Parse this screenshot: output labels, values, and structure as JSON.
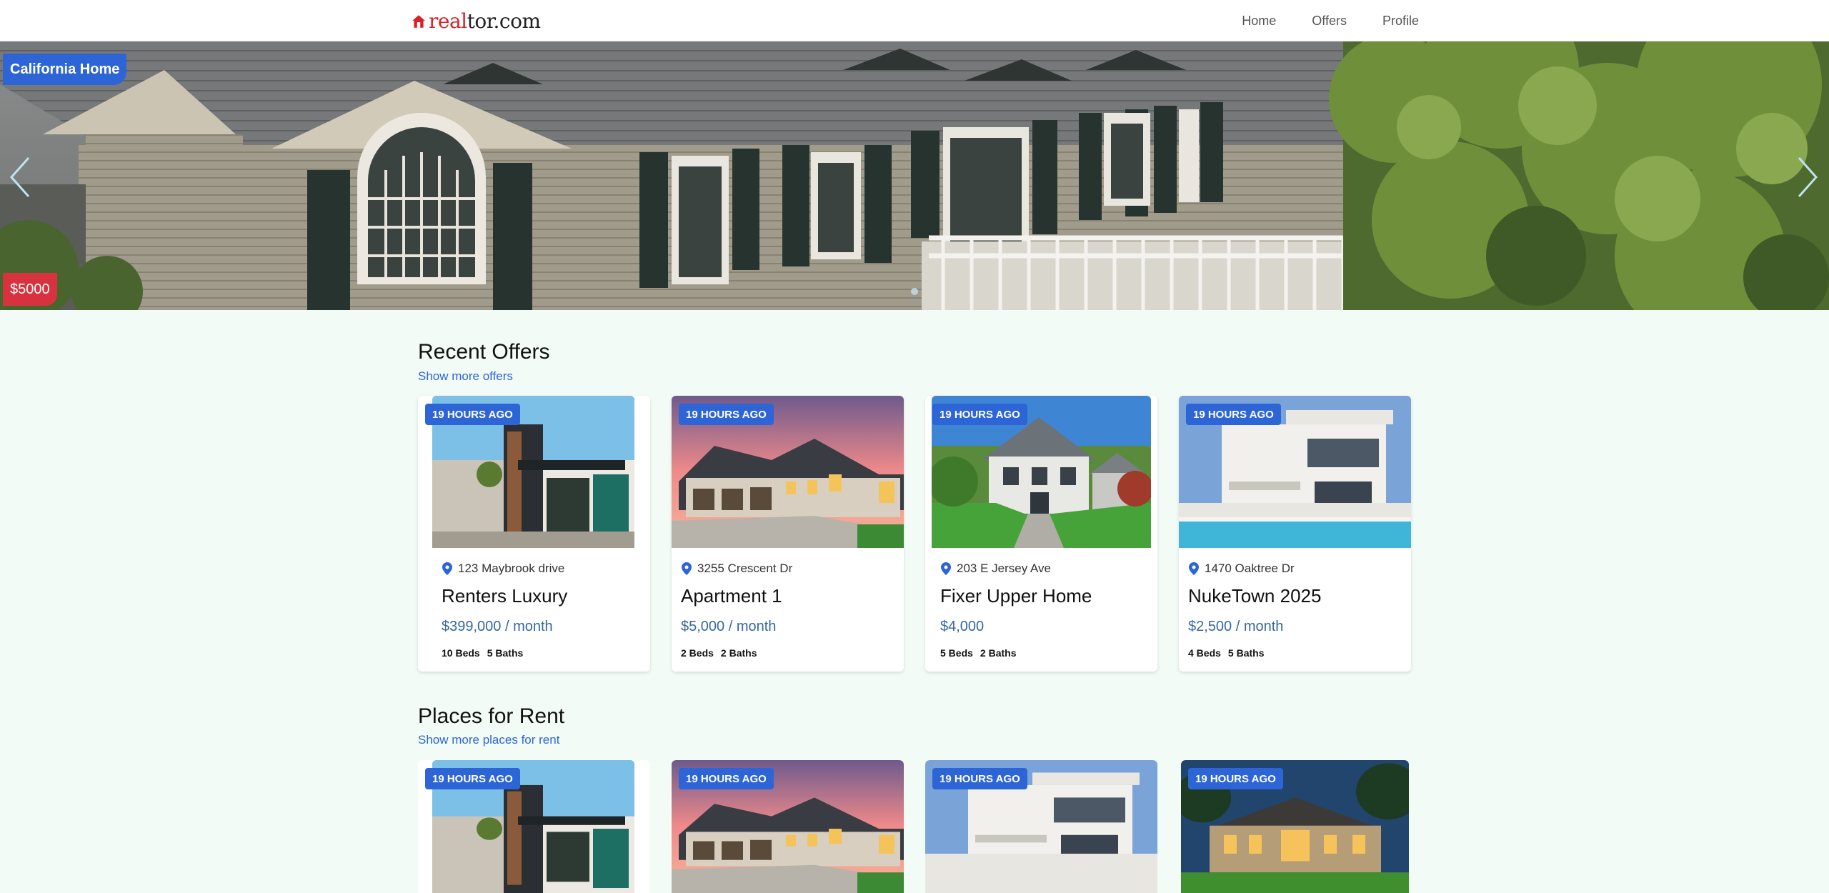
{
  "nav": {
    "logo_red": "real",
    "logo_dark": "tor.com",
    "links": [
      "Home",
      "Offers",
      "Profile"
    ]
  },
  "hero": {
    "title": "California Home",
    "price": "$5000"
  },
  "recent_offers": {
    "title": "Recent Offers",
    "link": "Show more offers",
    "cards": [
      {
        "time": "19 HOURS AGO",
        "address": "123 Maybrook drive",
        "name": "Renters Luxury",
        "price": "$399,000 / month",
        "beds": "10 Beds",
        "baths": "5 Baths"
      },
      {
        "time": "19 HOURS AGO",
        "address": "3255 Crescent Dr",
        "name": "Apartment 1",
        "price": "$5,000 / month",
        "beds": "2 Beds",
        "baths": "2 Baths"
      },
      {
        "time": "19 HOURS AGO",
        "address": "203 E Jersey Ave",
        "name": "Fixer Upper Home",
        "price": "$4,000",
        "beds": "5 Beds",
        "baths": "2 Baths"
      },
      {
        "time": "19 HOURS AGO",
        "address": "1470 Oaktree Dr",
        "name": "NukeTown 2025",
        "price": "$2,500 / month",
        "beds": "4 Beds",
        "baths": "5 Baths"
      }
    ]
  },
  "places_for_rent": {
    "title": "Places for Rent",
    "link": "Show more places for rent",
    "cards": [
      {
        "time": "19 HOURS AGO"
      },
      {
        "time": "19 HOURS AGO"
      },
      {
        "time": "19 HOURS AGO"
      },
      {
        "time": "19 HOURS AGO"
      }
    ]
  },
  "colors": {
    "accent": "#2d65d6",
    "price_badge": "#d8323e",
    "price_text": "#36679f",
    "page_bg": "#f2fbf6"
  },
  "icons": [
    "house-logo-icon",
    "chevron-left-icon",
    "chevron-right-icon",
    "map-pin-icon"
  ]
}
